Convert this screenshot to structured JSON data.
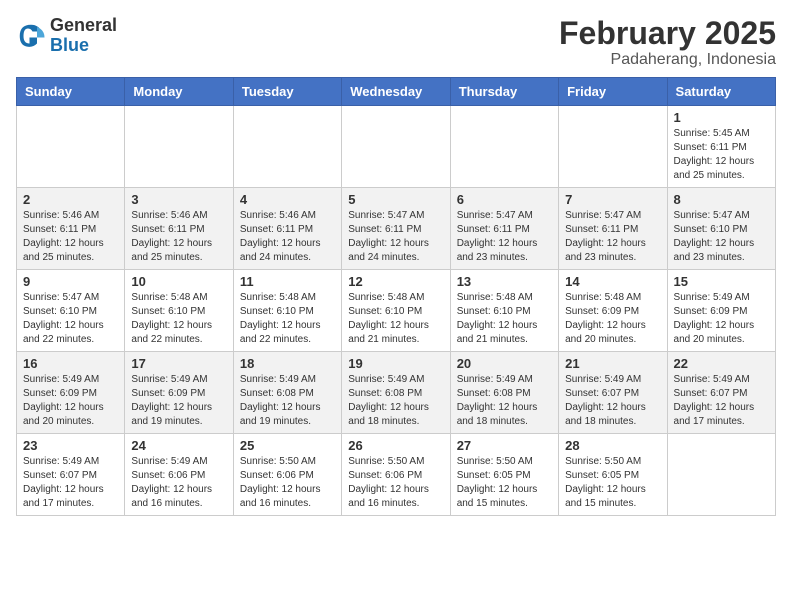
{
  "app": {
    "logo_general": "General",
    "logo_blue": "Blue"
  },
  "header": {
    "title": "February 2025",
    "subtitle": "Padaherang, Indonesia"
  },
  "weekdays": [
    "Sunday",
    "Monday",
    "Tuesday",
    "Wednesday",
    "Thursday",
    "Friday",
    "Saturday"
  ],
  "weeks": [
    [
      {
        "day": "",
        "info": ""
      },
      {
        "day": "",
        "info": ""
      },
      {
        "day": "",
        "info": ""
      },
      {
        "day": "",
        "info": ""
      },
      {
        "day": "",
        "info": ""
      },
      {
        "day": "",
        "info": ""
      },
      {
        "day": "1",
        "info": "Sunrise: 5:45 AM\nSunset: 6:11 PM\nDaylight: 12 hours\nand 25 minutes."
      }
    ],
    [
      {
        "day": "2",
        "info": "Sunrise: 5:46 AM\nSunset: 6:11 PM\nDaylight: 12 hours\nand 25 minutes."
      },
      {
        "day": "3",
        "info": "Sunrise: 5:46 AM\nSunset: 6:11 PM\nDaylight: 12 hours\nand 25 minutes."
      },
      {
        "day": "4",
        "info": "Sunrise: 5:46 AM\nSunset: 6:11 PM\nDaylight: 12 hours\nand 24 minutes."
      },
      {
        "day": "5",
        "info": "Sunrise: 5:47 AM\nSunset: 6:11 PM\nDaylight: 12 hours\nand 24 minutes."
      },
      {
        "day": "6",
        "info": "Sunrise: 5:47 AM\nSunset: 6:11 PM\nDaylight: 12 hours\nand 23 minutes."
      },
      {
        "day": "7",
        "info": "Sunrise: 5:47 AM\nSunset: 6:11 PM\nDaylight: 12 hours\nand 23 minutes."
      },
      {
        "day": "8",
        "info": "Sunrise: 5:47 AM\nSunset: 6:10 PM\nDaylight: 12 hours\nand 23 minutes."
      }
    ],
    [
      {
        "day": "9",
        "info": "Sunrise: 5:47 AM\nSunset: 6:10 PM\nDaylight: 12 hours\nand 22 minutes."
      },
      {
        "day": "10",
        "info": "Sunrise: 5:48 AM\nSunset: 6:10 PM\nDaylight: 12 hours\nand 22 minutes."
      },
      {
        "day": "11",
        "info": "Sunrise: 5:48 AM\nSunset: 6:10 PM\nDaylight: 12 hours\nand 22 minutes."
      },
      {
        "day": "12",
        "info": "Sunrise: 5:48 AM\nSunset: 6:10 PM\nDaylight: 12 hours\nand 21 minutes."
      },
      {
        "day": "13",
        "info": "Sunrise: 5:48 AM\nSunset: 6:10 PM\nDaylight: 12 hours\nand 21 minutes."
      },
      {
        "day": "14",
        "info": "Sunrise: 5:48 AM\nSunset: 6:09 PM\nDaylight: 12 hours\nand 20 minutes."
      },
      {
        "day": "15",
        "info": "Sunrise: 5:49 AM\nSunset: 6:09 PM\nDaylight: 12 hours\nand 20 minutes."
      }
    ],
    [
      {
        "day": "16",
        "info": "Sunrise: 5:49 AM\nSunset: 6:09 PM\nDaylight: 12 hours\nand 20 minutes."
      },
      {
        "day": "17",
        "info": "Sunrise: 5:49 AM\nSunset: 6:09 PM\nDaylight: 12 hours\nand 19 minutes."
      },
      {
        "day": "18",
        "info": "Sunrise: 5:49 AM\nSunset: 6:08 PM\nDaylight: 12 hours\nand 19 minutes."
      },
      {
        "day": "19",
        "info": "Sunrise: 5:49 AM\nSunset: 6:08 PM\nDaylight: 12 hours\nand 18 minutes."
      },
      {
        "day": "20",
        "info": "Sunrise: 5:49 AM\nSunset: 6:08 PM\nDaylight: 12 hours\nand 18 minutes."
      },
      {
        "day": "21",
        "info": "Sunrise: 5:49 AM\nSunset: 6:07 PM\nDaylight: 12 hours\nand 18 minutes."
      },
      {
        "day": "22",
        "info": "Sunrise: 5:49 AM\nSunset: 6:07 PM\nDaylight: 12 hours\nand 17 minutes."
      }
    ],
    [
      {
        "day": "23",
        "info": "Sunrise: 5:49 AM\nSunset: 6:07 PM\nDaylight: 12 hours\nand 17 minutes."
      },
      {
        "day": "24",
        "info": "Sunrise: 5:49 AM\nSunset: 6:06 PM\nDaylight: 12 hours\nand 16 minutes."
      },
      {
        "day": "25",
        "info": "Sunrise: 5:50 AM\nSunset: 6:06 PM\nDaylight: 12 hours\nand 16 minutes."
      },
      {
        "day": "26",
        "info": "Sunrise: 5:50 AM\nSunset: 6:06 PM\nDaylight: 12 hours\nand 16 minutes."
      },
      {
        "day": "27",
        "info": "Sunrise: 5:50 AM\nSunset: 6:05 PM\nDaylight: 12 hours\nand 15 minutes."
      },
      {
        "day": "28",
        "info": "Sunrise: 5:50 AM\nSunset: 6:05 PM\nDaylight: 12 hours\nand 15 minutes."
      },
      {
        "day": "",
        "info": ""
      }
    ]
  ]
}
